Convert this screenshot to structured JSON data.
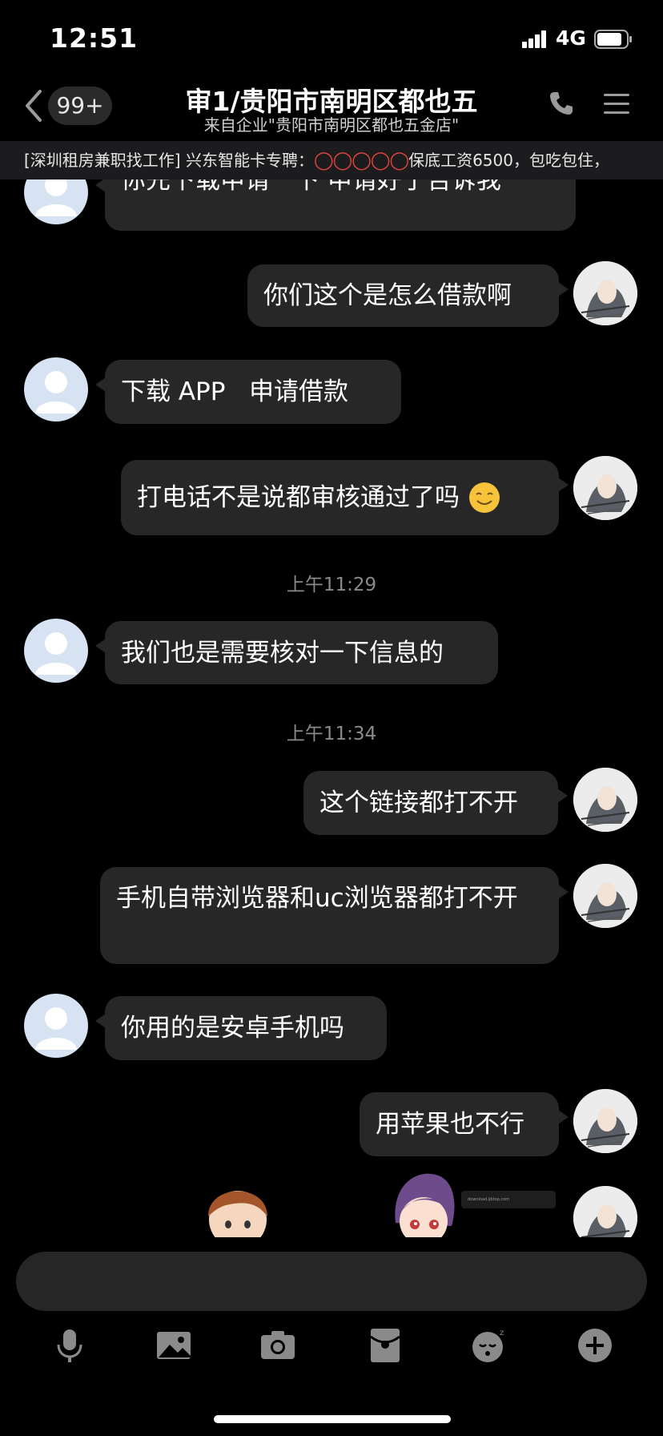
{
  "status": {
    "time": "12:51",
    "network": "4G"
  },
  "nav": {
    "unread_count": "99+",
    "title": "审1/贵阳市南明区都也五",
    "subtitle": "来自企业\"贵阳市南明区都也五金店\""
  },
  "announcement": {
    "prefix": "[深圳租房兼职找工作] 兴东智能卡专聘：",
    "circles": "◯◯◯◯◯",
    "suffix": "保底工资6500，包吃包住，"
  },
  "messages": [
    {
      "side": "left",
      "text": "你先下载申请一下   申请好了告诉我"
    },
    {
      "side": "right",
      "text": "你们这个是怎么借款啊"
    },
    {
      "side": "left",
      "text": "下载 APP   申请借款"
    },
    {
      "side": "right",
      "text": "打电话不是说都审核通过了吗",
      "emoji": "smile-emoji"
    },
    {
      "timestamp": "上午11:29"
    },
    {
      "side": "left",
      "text": "我们也是需要核对一下信息的"
    },
    {
      "timestamp": "上午11:34"
    },
    {
      "side": "right",
      "text": "这个链接都打不开"
    },
    {
      "side": "right",
      "text": "手机自带浏览器和uc浏览器都打不开"
    },
    {
      "side": "left",
      "text": "你用的是安卓手机吗"
    },
    {
      "side": "right",
      "text": "用苹果也不行"
    }
  ],
  "partial_screenshot_text": "download.ljbtop.com",
  "toolbar": {
    "icons": [
      "microphone-icon",
      "image-icon",
      "camera-icon",
      "red-packet-icon",
      "emoji-icon",
      "plus-icon"
    ]
  },
  "colors": {
    "background": "#000000",
    "bubble": "#272727",
    "announcement_circles": "#e8453c",
    "timestamp": "#8a8a8a"
  }
}
